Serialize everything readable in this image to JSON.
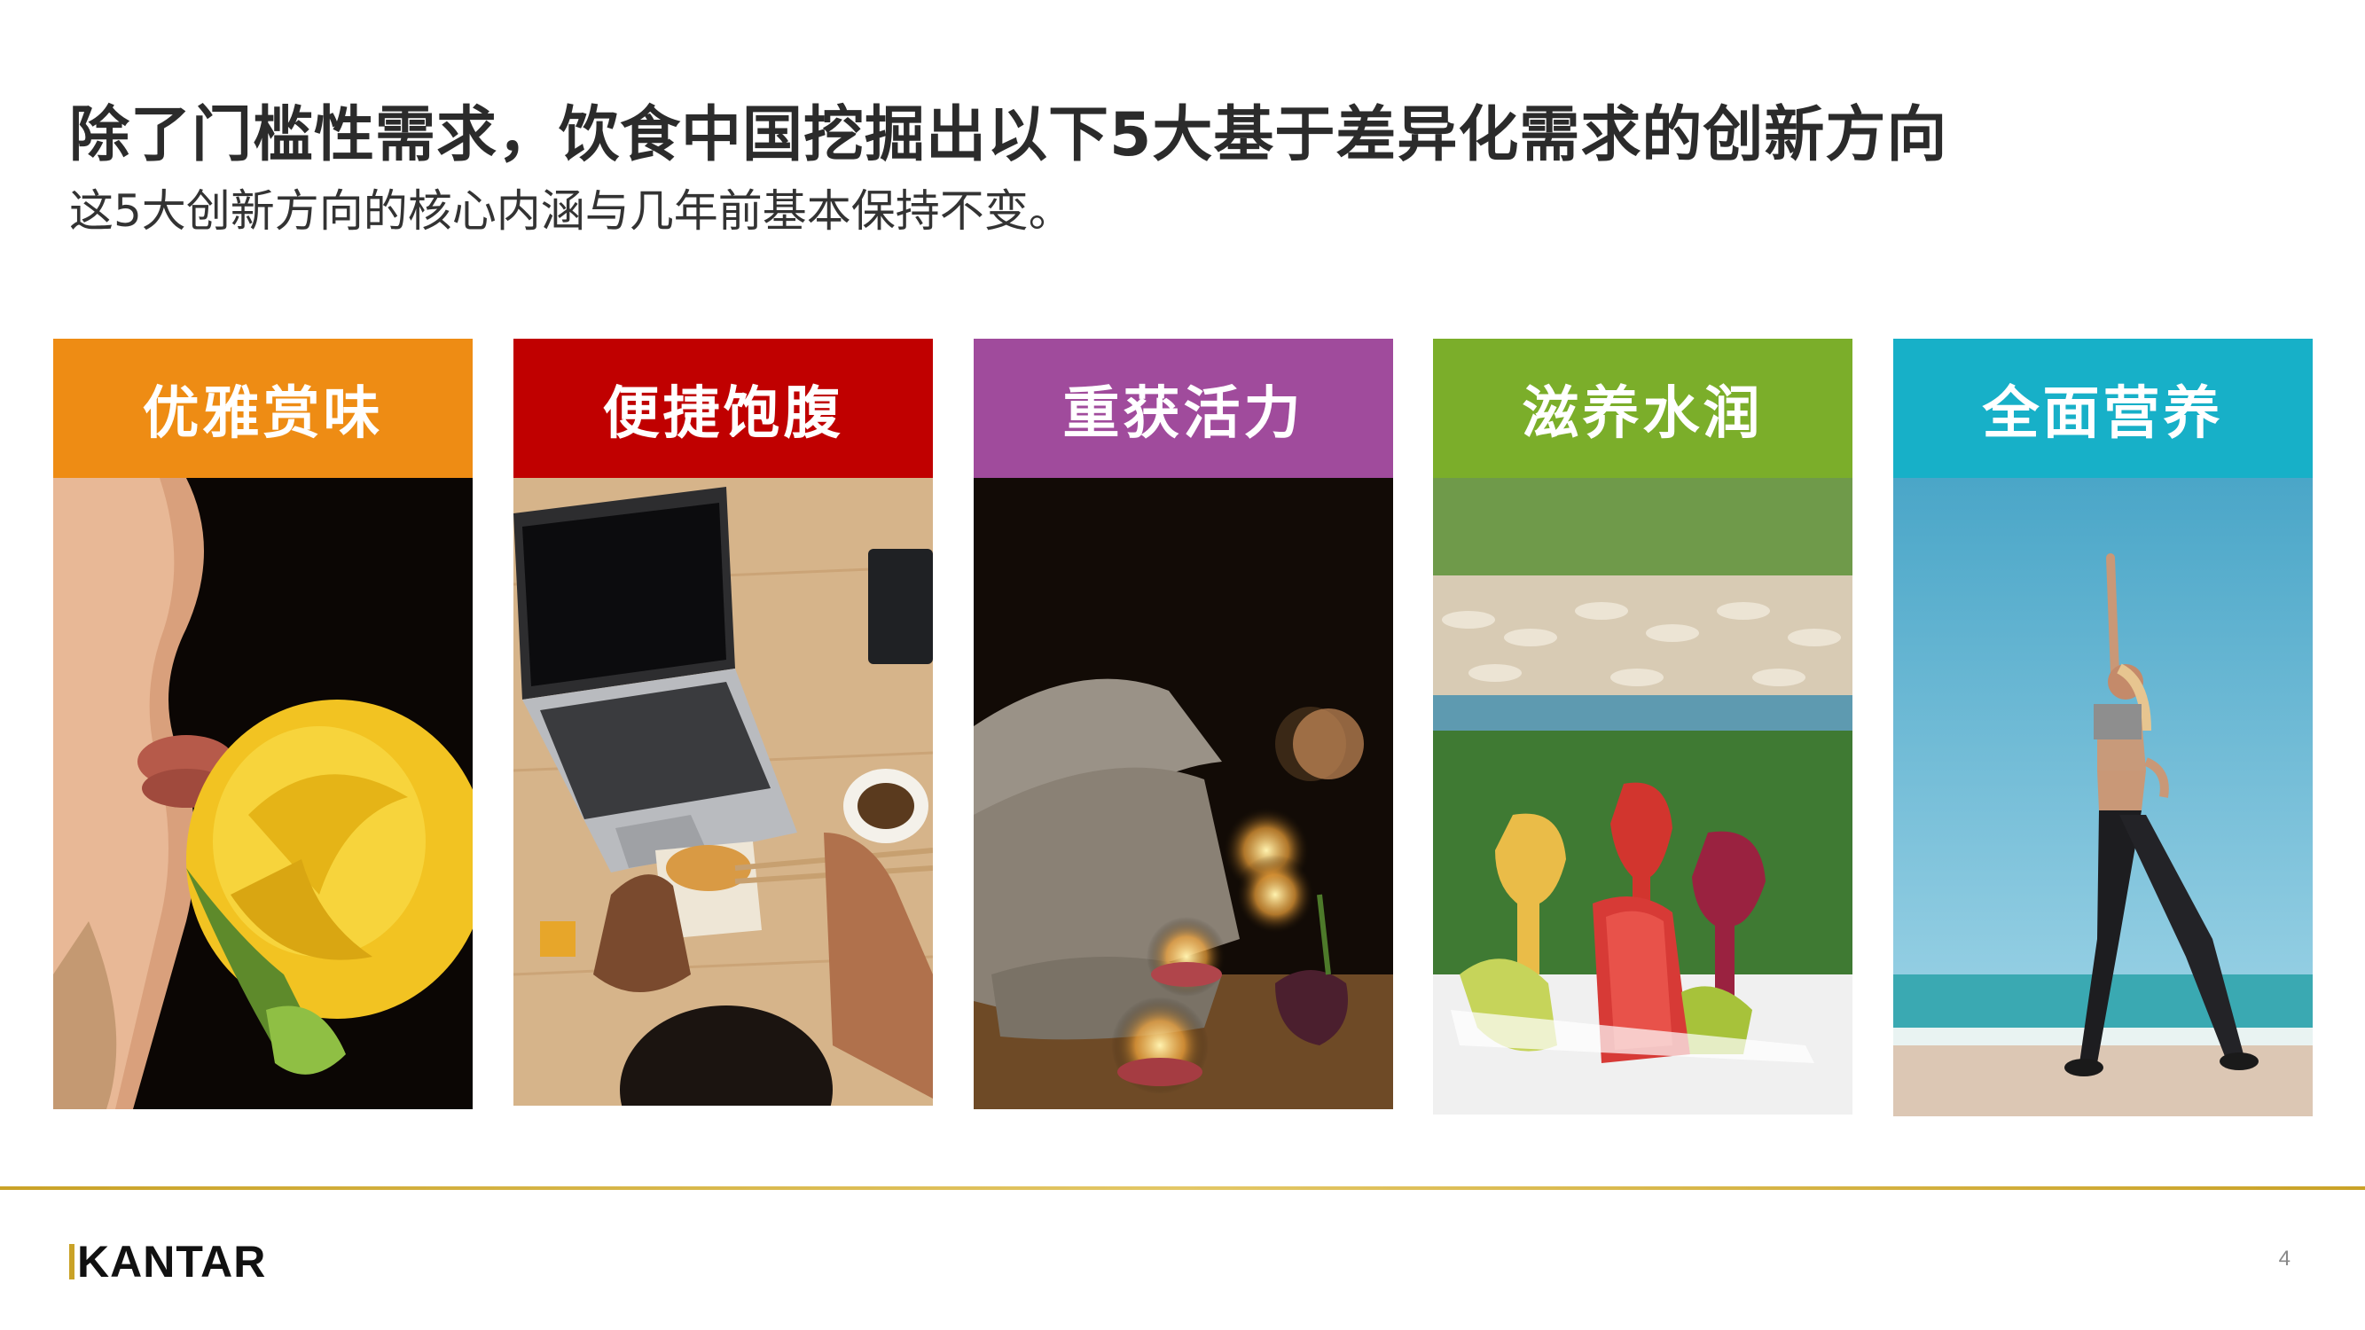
{
  "slide": {
    "title": "除了门槛性需求，饮食中国挖掘出以下5大基于差异化需求的创新方向",
    "subtitle": "这5大创新方向的核心内涵与几年前基本保持不变。",
    "page_number": "4"
  },
  "cards": [
    {
      "label": "优雅赏味",
      "color": "#EE8C14",
      "image": "rose-lips-photo"
    },
    {
      "label": "便捷饱腹",
      "color": "#C00000",
      "image": "laptop-noodles-photo"
    },
    {
      "label": "重获活力",
      "color": "#A04B9C",
      "image": "spa-candles-photo"
    },
    {
      "label": "滋养水润",
      "color": "#7BAE2A",
      "image": "fruit-juice-beach-photo"
    },
    {
      "label": "全面营养",
      "color": "#17B0C8",
      "image": "yoga-beach-photo"
    }
  ],
  "footer": {
    "logo_text": "KANTAR",
    "accent_color": "#C9A227"
  }
}
